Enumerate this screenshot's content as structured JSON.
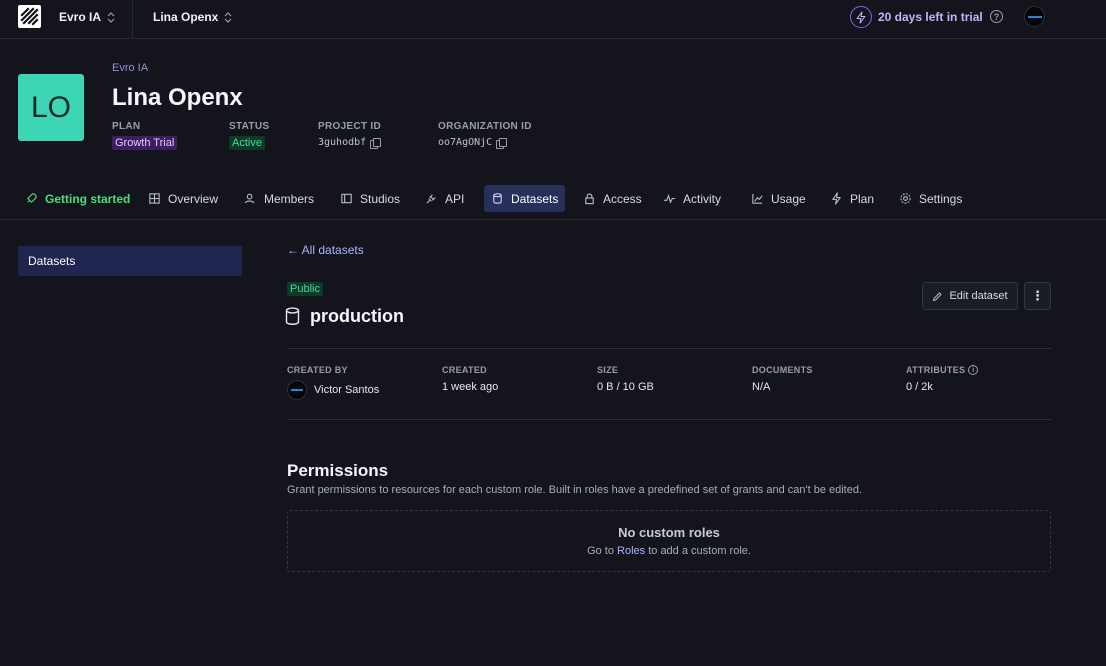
{
  "topbar": {
    "org_name": "Evro IA",
    "project_name": "Lina Openx",
    "trial_text": "20 days left in trial"
  },
  "header": {
    "avatar_initials": "LO",
    "org_breadcrumb": "Evro IA",
    "title": "Lina Openx",
    "plan_label": "PLAN",
    "plan_value": "Growth Trial",
    "status_label": "STATUS",
    "status_value": "Active",
    "project_id_label": "PROJECT ID",
    "project_id": "3guhodbf",
    "org_id_label": "ORGANIZATION ID",
    "org_id": "oo7AgONjC"
  },
  "tabs": [
    {
      "label": "Getting started",
      "icon": "rocket-icon"
    },
    {
      "label": "Overview",
      "icon": "dashboard-icon"
    },
    {
      "label": "Members",
      "icon": "users-icon"
    },
    {
      "label": "Studios",
      "icon": "layout-icon"
    },
    {
      "label": "API",
      "icon": "plug-icon"
    },
    {
      "label": "Datasets",
      "icon": "database-icon",
      "active": true
    },
    {
      "label": "Access",
      "icon": "lock-icon"
    },
    {
      "label": "Activity",
      "icon": "activity-icon"
    },
    {
      "label": "Usage",
      "icon": "chart-icon"
    },
    {
      "label": "Plan",
      "icon": "bolt-icon"
    },
    {
      "label": "Settings",
      "icon": "gear-icon"
    }
  ],
  "sidebar": {
    "items": [
      {
        "label": "Datasets"
      }
    ]
  },
  "dataset": {
    "back_link": "← All datasets",
    "visibility": "Public",
    "name": "production",
    "edit_label": "Edit dataset",
    "more_label": "⋮",
    "stats": {
      "created_by_label": "CREATED BY",
      "created_by": "Victor Santos",
      "created_label": "CREATED",
      "created": "1 week ago",
      "size_label": "SIZE",
      "size": "0 B / 10 GB",
      "documents_label": "DOCUMENTS",
      "documents": "N/A",
      "attributes_label": "ATTRIBUTES",
      "attributes": "0 / 2k"
    }
  },
  "permissions": {
    "title": "Permissions",
    "description": "Grant permissions to resources for each custom role. Built in roles have a predefined set of grants and can't be edited.",
    "empty_title": "No custom roles",
    "empty_prefix": "Go to ",
    "empty_link": "Roles",
    "empty_suffix": " to add a custom role."
  },
  "colors": {
    "background": "#13141c",
    "accent": "#a8b4ff",
    "active_tab": "#26305a",
    "success": "#3ddc97",
    "avatar": "#3dd6b4"
  }
}
